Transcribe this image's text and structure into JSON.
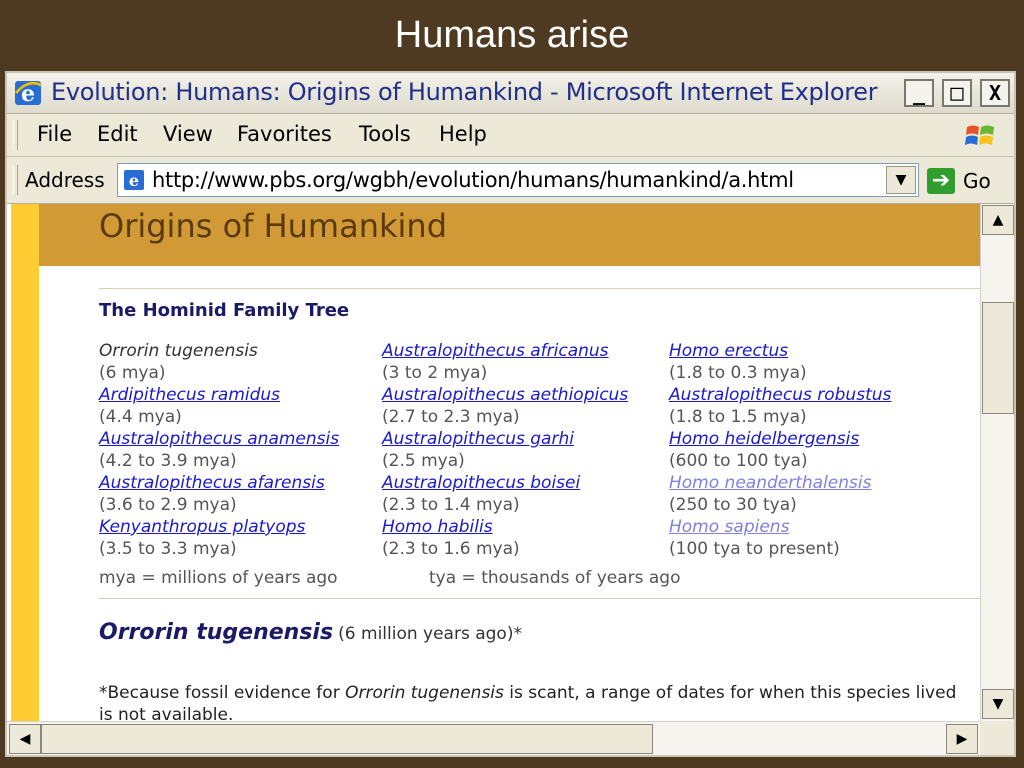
{
  "slide": {
    "title": "Humans arise"
  },
  "window": {
    "title": "Evolution: Humans: Origins of Humankind - Microsoft Internet Explorer",
    "minimize": "_",
    "maximize": "□",
    "close": "X"
  },
  "menu": {
    "items": [
      {
        "label": "File"
      },
      {
        "label": "Edit"
      },
      {
        "label": "View"
      },
      {
        "label": "Favorites"
      },
      {
        "label": "Tools"
      },
      {
        "label": "Help"
      }
    ]
  },
  "address": {
    "label": "Address",
    "url": "http://www.pbs.org/wgbh/evolution/humans/humankind/a.html",
    "go_label": "Go"
  },
  "page": {
    "heading": "Origins of Humankind",
    "tree_heading": "The Hominid Family Tree",
    "columns": [
      [
        {
          "name": "Orrorin tugenensis",
          "range": "(6 mya)",
          "style": "plain"
        },
        {
          "name": "Ardipithecus ramidus",
          "range": "(4.4 mya)",
          "style": "link"
        },
        {
          "name": "Australopithecus anamensis",
          "range": "(4.2 to 3.9 mya)",
          "style": "link"
        },
        {
          "name": "Australopithecus afarensis",
          "range": "(3.6 to 2.9 mya)",
          "style": "link"
        },
        {
          "name": "Kenyanthropus platyops",
          "range": "(3.5 to 3.3 mya)",
          "style": "link"
        }
      ],
      [
        {
          "name": "Australopithecus africanus",
          "range": "(3 to 2 mya)",
          "style": "link"
        },
        {
          "name": "Australopithecus aethiopicus",
          "range": "(2.7 to 2.3 mya)",
          "style": "link"
        },
        {
          "name": "Australopithecus garhi",
          "range": "(2.5 mya)",
          "style": "link"
        },
        {
          "name": "Australopithecus boisei",
          "range": "(2.3 to 1.4 mya)",
          "style": "link"
        },
        {
          "name": "Homo habilis",
          "range": "(2.3 to 1.6 mya)",
          "style": "link"
        }
      ],
      [
        {
          "name": "Homo erectus",
          "range": "(1.8 to 0.3 mya)",
          "style": "link"
        },
        {
          "name": "Australopithecus robustus",
          "range": "(1.8 to 1.5 mya)",
          "style": "link"
        },
        {
          "name": "Homo heidelbergensis",
          "range": "(600 to 100 tya)",
          "style": "link"
        },
        {
          "name": "Homo neanderthalensis",
          "range": "(250 to 30 tya)",
          "style": "visited"
        },
        {
          "name": "Homo sapiens",
          "range": "(100 tya to present)",
          "style": "visited"
        }
      ]
    ],
    "legend_mya": "mya = millions of years ago",
    "legend_tya": "tya = thousands of years ago",
    "section_title": "Orrorin tugenensis",
    "section_subtitle": "(6 million years ago)*",
    "footnote_pre": "*Because fossil evidence for ",
    "footnote_italic": "Orrorin tugenensis",
    "footnote_post": " is scant, a range of dates for when this species lived is not available."
  }
}
